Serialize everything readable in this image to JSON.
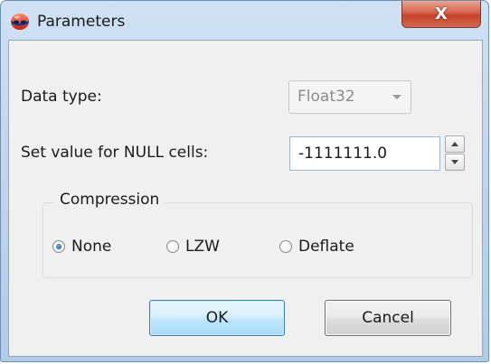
{
  "window": {
    "title": "Parameters",
    "close_label": "X",
    "app_icon": "red-blue-sphere-icon"
  },
  "form": {
    "data_type_label": "Data type:",
    "data_type_value": "Float32",
    "data_type_enabled": false,
    "null_label": "Set value for NULL cells:",
    "null_value": "-1111111.0"
  },
  "compression": {
    "title": "Compression",
    "options": [
      {
        "label": "None",
        "checked": true
      },
      {
        "label": "LZW",
        "checked": false
      },
      {
        "label": "Deflate",
        "checked": false
      }
    ]
  },
  "buttons": {
    "ok_label": "OK",
    "cancel_label": "Cancel"
  },
  "colors": {
    "title_bar": "#c4d9ef",
    "close_button": "#c7452b",
    "ok_accent": "#3c7fb1",
    "radio_selected": "#1f5fa8"
  }
}
